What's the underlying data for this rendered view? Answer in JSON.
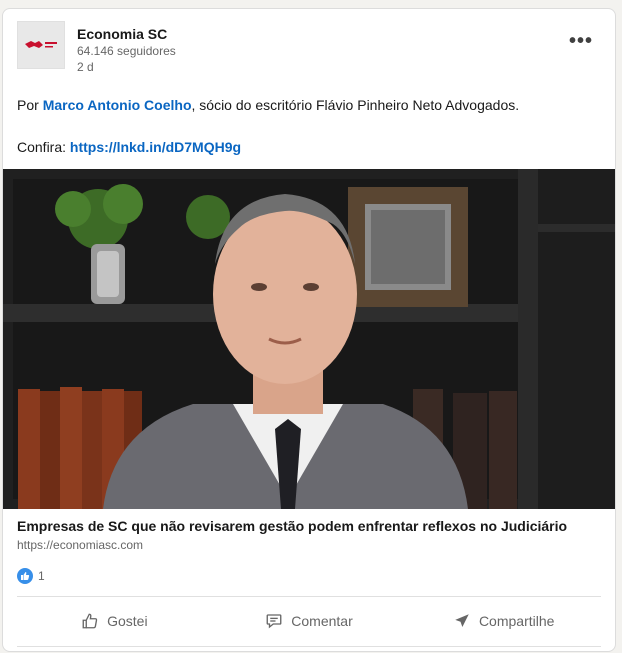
{
  "author": {
    "name": "Economia SC",
    "followers": "64.146 seguidores",
    "time": "2 d"
  },
  "post": {
    "prefix": "Por ",
    "person_link": "Marco Antonio Coelho",
    "suffix": ", sócio do escritório Flávio Pinheiro Neto Advogados.",
    "confira_label": "Confira: ",
    "short_link": "https://lnkd.in/dD7MQH9g"
  },
  "article": {
    "title": "Empresas de SC que não revisarem gestão podem enfrentar reflexos no Judiciário",
    "domain": "https://economiasc.com"
  },
  "reactions": {
    "count": "1"
  },
  "actions": {
    "like": "Gostei",
    "comment": "Comentar",
    "share": "Compartilhe"
  },
  "colors": {
    "link": "#0a66c2",
    "like_badge": "#378fe9"
  }
}
